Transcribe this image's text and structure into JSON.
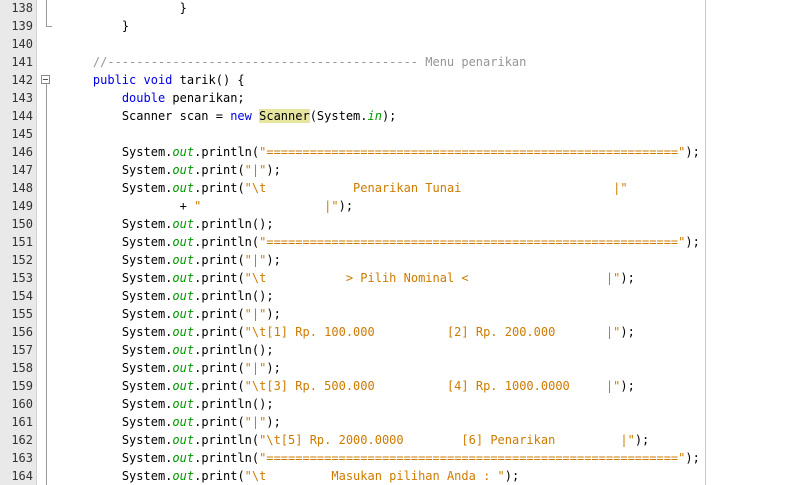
{
  "lines": [
    {
      "num": "138",
      "indent": 16,
      "parts": [
        {
          "t": "}",
          "c": ""
        }
      ]
    },
    {
      "num": "139",
      "indent": 8,
      "parts": [
        {
          "t": "}",
          "c": ""
        }
      ]
    },
    {
      "num": "140",
      "indent": 0,
      "parts": []
    },
    {
      "num": "141",
      "indent": 4,
      "parts": [
        {
          "t": "//------------------------------------------- Menu penarikan",
          "c": "cm"
        }
      ]
    },
    {
      "num": "142",
      "indent": 4,
      "parts": [
        {
          "t": "public",
          "c": "kw"
        },
        {
          "t": " ",
          "c": ""
        },
        {
          "t": "void",
          "c": "kw"
        },
        {
          "t": " tarik() {",
          "c": ""
        }
      ]
    },
    {
      "num": "143",
      "indent": 8,
      "parts": [
        {
          "t": "double",
          "c": "kw"
        },
        {
          "t": " penarikan;",
          "c": ""
        }
      ]
    },
    {
      "num": "144",
      "indent": 8,
      "parts": [
        {
          "t": "Scanner scan = ",
          "c": ""
        },
        {
          "t": "new",
          "c": "kw"
        },
        {
          "t": " ",
          "c": ""
        },
        {
          "t": "Scanner",
          "c": "hl"
        },
        {
          "t": "(System.",
          "c": ""
        },
        {
          "t": "in",
          "c": "fld"
        },
        {
          "t": ");",
          "c": ""
        }
      ]
    },
    {
      "num": "145",
      "indent": 0,
      "parts": []
    },
    {
      "num": "146",
      "indent": 8,
      "parts": [
        {
          "t": "System.",
          "c": ""
        },
        {
          "t": "out",
          "c": "fld"
        },
        {
          "t": ".println(",
          "c": ""
        },
        {
          "t": "\"=========================================================\"",
          "c": "str"
        },
        {
          "t": ");",
          "c": ""
        }
      ]
    },
    {
      "num": "147",
      "indent": 8,
      "parts": [
        {
          "t": "System.",
          "c": ""
        },
        {
          "t": "out",
          "c": "fld"
        },
        {
          "t": ".print(",
          "c": ""
        },
        {
          "t": "\"|\"",
          "c": "str"
        },
        {
          "t": ");",
          "c": ""
        }
      ]
    },
    {
      "num": "148",
      "indent": 8,
      "parts": [
        {
          "t": "System.",
          "c": ""
        },
        {
          "t": "out",
          "c": "fld"
        },
        {
          "t": ".print(",
          "c": ""
        },
        {
          "t": "\"\\t            Penarikan Tunai                     |\"",
          "c": "str"
        }
      ]
    },
    {
      "num": "149",
      "indent": 16,
      "parts": [
        {
          "t": "+ ",
          "c": ""
        },
        {
          "t": "\"                 |\"",
          "c": "str"
        },
        {
          "t": ");",
          "c": ""
        }
      ]
    },
    {
      "num": "150",
      "indent": 8,
      "parts": [
        {
          "t": "System.",
          "c": ""
        },
        {
          "t": "out",
          "c": "fld"
        },
        {
          "t": ".println();",
          "c": ""
        }
      ]
    },
    {
      "num": "151",
      "indent": 8,
      "parts": [
        {
          "t": "System.",
          "c": ""
        },
        {
          "t": "out",
          "c": "fld"
        },
        {
          "t": ".println(",
          "c": ""
        },
        {
          "t": "\"=========================================================\"",
          "c": "str"
        },
        {
          "t": ");",
          "c": ""
        }
      ]
    },
    {
      "num": "152",
      "indent": 8,
      "parts": [
        {
          "t": "System.",
          "c": ""
        },
        {
          "t": "out",
          "c": "fld"
        },
        {
          "t": ".print(",
          "c": ""
        },
        {
          "t": "\"|\"",
          "c": "str"
        },
        {
          "t": ");",
          "c": ""
        }
      ]
    },
    {
      "num": "153",
      "indent": 8,
      "parts": [
        {
          "t": "System.",
          "c": ""
        },
        {
          "t": "out",
          "c": "fld"
        },
        {
          "t": ".print(",
          "c": ""
        },
        {
          "t": "\"\\t           > Pilih Nominal <                   |\"",
          "c": "str"
        },
        {
          "t": ");",
          "c": ""
        }
      ]
    },
    {
      "num": "154",
      "indent": 8,
      "parts": [
        {
          "t": "System.",
          "c": ""
        },
        {
          "t": "out",
          "c": "fld"
        },
        {
          "t": ".println();",
          "c": ""
        }
      ]
    },
    {
      "num": "155",
      "indent": 8,
      "parts": [
        {
          "t": "System.",
          "c": ""
        },
        {
          "t": "out",
          "c": "fld"
        },
        {
          "t": ".print(",
          "c": ""
        },
        {
          "t": "\"|\"",
          "c": "str"
        },
        {
          "t": ");",
          "c": ""
        }
      ]
    },
    {
      "num": "156",
      "indent": 8,
      "parts": [
        {
          "t": "System.",
          "c": ""
        },
        {
          "t": "out",
          "c": "fld"
        },
        {
          "t": ".print(",
          "c": ""
        },
        {
          "t": "\"\\t[1] Rp. 100.000          [2] Rp. 200.000       |\"",
          "c": "str"
        },
        {
          "t": ");",
          "c": ""
        }
      ]
    },
    {
      "num": "157",
      "indent": 8,
      "parts": [
        {
          "t": "System.",
          "c": ""
        },
        {
          "t": "out",
          "c": "fld"
        },
        {
          "t": ".println();",
          "c": ""
        }
      ]
    },
    {
      "num": "158",
      "indent": 8,
      "parts": [
        {
          "t": "System.",
          "c": ""
        },
        {
          "t": "out",
          "c": "fld"
        },
        {
          "t": ".print(",
          "c": ""
        },
        {
          "t": "\"|\"",
          "c": "str"
        },
        {
          "t": ");",
          "c": ""
        }
      ]
    },
    {
      "num": "159",
      "indent": 8,
      "parts": [
        {
          "t": "System.",
          "c": ""
        },
        {
          "t": "out",
          "c": "fld"
        },
        {
          "t": ".print(",
          "c": ""
        },
        {
          "t": "\"\\t[3] Rp. 500.000          [4] Rp. 1000.0000     |\"",
          "c": "str"
        },
        {
          "t": ");",
          "c": ""
        }
      ]
    },
    {
      "num": "160",
      "indent": 8,
      "parts": [
        {
          "t": "System.",
          "c": ""
        },
        {
          "t": "out",
          "c": "fld"
        },
        {
          "t": ".println();",
          "c": ""
        }
      ]
    },
    {
      "num": "161",
      "indent": 8,
      "parts": [
        {
          "t": "System.",
          "c": ""
        },
        {
          "t": "out",
          "c": "fld"
        },
        {
          "t": ".print(",
          "c": ""
        },
        {
          "t": "\"|\"",
          "c": "str"
        },
        {
          "t": ");",
          "c": ""
        }
      ]
    },
    {
      "num": "162",
      "indent": 8,
      "parts": [
        {
          "t": "System.",
          "c": ""
        },
        {
          "t": "out",
          "c": "fld"
        },
        {
          "t": ".println(",
          "c": ""
        },
        {
          "t": "\"\\t[5] Rp. 2000.0000        [6] Penarikan         |\"",
          "c": "str"
        },
        {
          "t": ");",
          "c": ""
        }
      ]
    },
    {
      "num": "163",
      "indent": 8,
      "parts": [
        {
          "t": "System.",
          "c": ""
        },
        {
          "t": "out",
          "c": "fld"
        },
        {
          "t": ".println(",
          "c": ""
        },
        {
          "t": "\"=========================================================\"",
          "c": "str"
        },
        {
          "t": ");",
          "c": ""
        }
      ]
    },
    {
      "num": "164",
      "indent": 8,
      "parts": [
        {
          "t": "System.",
          "c": ""
        },
        {
          "t": "out",
          "c": "fld"
        },
        {
          "t": ".print(",
          "c": ""
        },
        {
          "t": "\"\\t         Masukan pilihan Anda : \"",
          "c": "str"
        },
        {
          "t": ");",
          "c": ""
        }
      ]
    }
  ],
  "fold": {
    "at": "142",
    "state": "expanded"
  }
}
